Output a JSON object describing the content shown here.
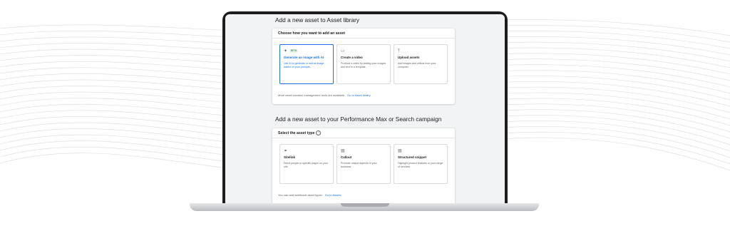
{
  "library": {
    "title": "Add a new asset to Asset library",
    "card_heading": "Choose how you want to add an asset",
    "tiles": [
      {
        "icon": "sparkle-icon",
        "title": "Generate an image with AI",
        "badge": "BETA",
        "desc": "Use AI to generate or edit an image based on your prompts."
      },
      {
        "icon": "video-icon",
        "title": "Create a video",
        "desc": "Produce a video by adding your images and text to a template"
      },
      {
        "icon": "upload-icon",
        "title": "Upload assets",
        "desc": "Add images and videos from your computer"
      }
    ],
    "footnote": "More asset creation management tools are available.",
    "footnote_link": "Go to Asset library"
  },
  "campaign": {
    "title": "Add a new asset to your Performance Max or Search campaign",
    "card_heading": "Select the asset type",
    "tiles": [
      {
        "icon": "link-icon",
        "title": "Sitelink",
        "desc": "Direct people to specific pages on your site"
      },
      {
        "icon": "document-icon",
        "title": "Callout",
        "desc": "Promote unique aspects of your business"
      },
      {
        "icon": "document-icon",
        "title": "Structured snippet",
        "desc": "Highlight product features or your range of services"
      }
    ],
    "footnote": "You can add additional asset types.",
    "footnote_link": "Go to Assets"
  },
  "colors": {
    "accent": "#1a73e8",
    "laptop": "#1d1d1f",
    "screen": "#f1f3f4"
  }
}
